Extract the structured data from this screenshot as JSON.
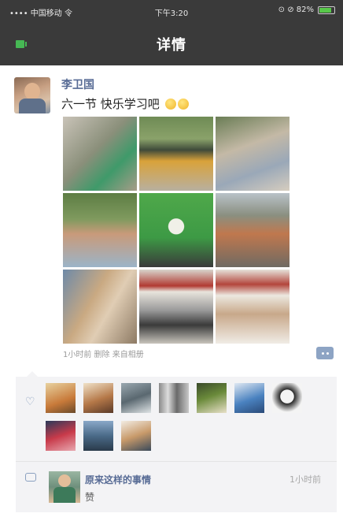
{
  "status_bar": {
    "left": "•••• 中国移动 令",
    "time": "下午3:20",
    "right": "⊙ ⊘ 82%",
    "battery_level": 0.82,
    "colors": {
      "bar": "#3a3a3a",
      "battery": "#58c84a"
    }
  },
  "nav": {
    "back_icon": "back-arrow-icon",
    "title": "详情"
  },
  "post": {
    "author": "李卫国",
    "text": "六一节 快乐学习吧",
    "emoji": [
      "smile-emoji",
      "smile-emoji"
    ],
    "photos": [
      "photo-classroom-desk",
      "photo-school-bus",
      "photo-people-outdoor",
      "photo-tree-gathering",
      "photo-award-ceremony",
      "photo-teacher-portrait",
      "photo-office-room",
      "photo-hall-banner",
      "photo-conference-table"
    ],
    "time": "1小时前  删除  来自相册",
    "more_icon": "more-dots-icon"
  },
  "likes": {
    "icon": "heart-icon",
    "avatars": [
      "avatar-1",
      "avatar-2",
      "avatar-3",
      "avatar-4",
      "avatar-5",
      "avatar-6",
      "avatar-7",
      "avatar-8",
      "avatar-9",
      "avatar-10"
    ]
  },
  "comment": {
    "icon": "comment-icon",
    "author": "原来这样的事情",
    "time": "1小时前",
    "text": "赞"
  },
  "colors": {
    "link": "#576b95",
    "panel": "#f3f3f5"
  }
}
